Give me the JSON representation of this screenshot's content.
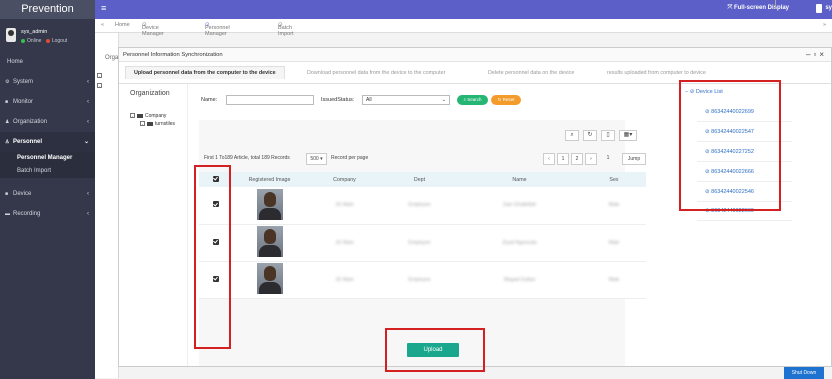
{
  "app": {
    "brand": "Prevention",
    "user": "sys_admin",
    "status_online": "Online",
    "logout": "Logout",
    "full_screen": "Full-screen Display",
    "user_short": "sy"
  },
  "sidebar": {
    "items": [
      {
        "label": "Home"
      },
      {
        "label": "System"
      },
      {
        "label": "Monitor"
      },
      {
        "label": "Organization"
      },
      {
        "label": "Personnel"
      },
      {
        "label": "Device"
      },
      {
        "label": "Recording"
      }
    ],
    "personnel_sub": [
      "Personnel Manager",
      "Batch Import"
    ]
  },
  "tabs": {
    "home": "Home",
    "device_manager": "Device Manager",
    "personnel_manager": "Personnel Manager",
    "batch_import": "Batch Import",
    "bg_org_label": "Orga"
  },
  "modal": {
    "title": "Personnel Information Synchronization",
    "tabs": [
      "Upload personnel data from the computer to the device",
      "Download personnel data from the device to the computer",
      "Delete personnel data on the device",
      "results uploaded from computer to device"
    ],
    "org_title": "Organization",
    "org_nodes": [
      "Company",
      "turnstiles"
    ],
    "filter": {
      "name_label": "Name:",
      "name_value": "",
      "issued_label": "IssuedStatus:",
      "issued_value": "All",
      "search": "Search",
      "reset": "Reset"
    },
    "pager": {
      "info": "First 1 To189 Article, total 189 Records",
      "per_page_value": "500",
      "per_page_label": "Record per page",
      "prev": "‹",
      "page1": "1",
      "page2": "2",
      "next": "›",
      "jump_value": "1",
      "jump": "Jump"
    },
    "columns": [
      "Registered Image",
      "Company",
      "Dept",
      "Name",
      "Sex"
    ],
    "rows": [
      {
        "company": "JG Main",
        "dept": "Employee",
        "name": "Zain Ghallellah",
        "sex": "Male"
      },
      {
        "company": "JG Main",
        "dept": "Employee",
        "name": "Ziyad Ngonzalo",
        "sex": "Male"
      },
      {
        "company": "JG Main",
        "dept": "Employee",
        "name": "Wagad Gultan",
        "sex": "Male"
      }
    ],
    "device_list_title": "Device List",
    "devices": [
      "86342440022699",
      "86342440022547",
      "86342440227252",
      "86342440022666",
      "86342440022546",
      "86342440022669"
    ],
    "upload": "Upload"
  },
  "footer": {
    "shutdown": "Shut Down"
  }
}
